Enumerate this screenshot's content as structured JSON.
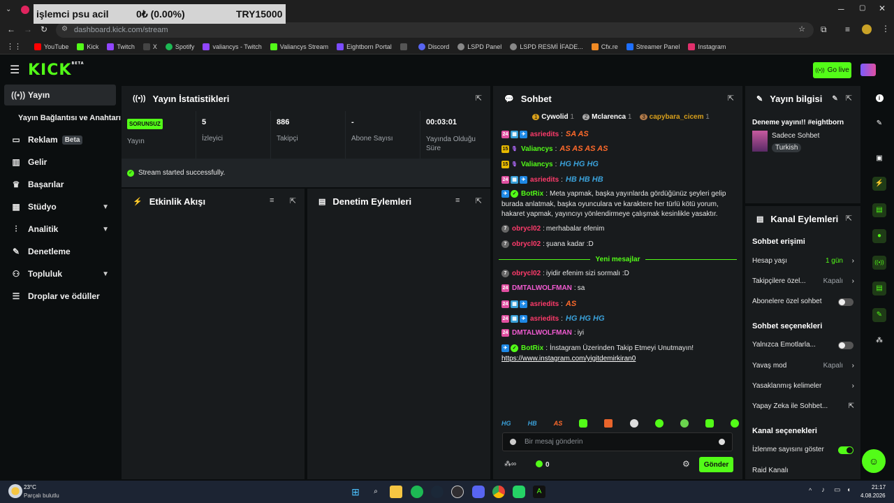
{
  "overlay": {
    "name": "işlemci psu acil",
    "value": "0₺ (0.00%)",
    "amount": "TRY15000"
  },
  "browser": {
    "url": "dashboard.kick.com/stream",
    "bookmarks": [
      "YouTube",
      "Kick",
      "Twitch",
      "X",
      "Spotify",
      "valiancys - Twitch",
      "Valiancys Stream",
      "Eightborn Portal",
      "Discord",
      "LSPD Panel",
      "LSPD RESMİ İFADE...",
      "Cfx.re",
      "Streamer Panel",
      "Instagram"
    ]
  },
  "header": {
    "logo": "KICK",
    "logo_sup": "BETA",
    "go_live": "Go live"
  },
  "sidebar": {
    "items": [
      {
        "label": "Yayın",
        "icon": "broadcast-icon"
      },
      {
        "label": "Yayın Bağlantısı ve Anahtarı",
        "icon": ""
      },
      {
        "label": "Reklam",
        "icon": "ad-icon",
        "badge": "Beta"
      },
      {
        "label": "Gelir",
        "icon": "chart-icon"
      },
      {
        "label": "Başarılar",
        "icon": "trophy-icon"
      },
      {
        "label": "Stüdyo",
        "icon": "studio-icon"
      },
      {
        "label": "Analitik",
        "icon": "analytics-icon"
      },
      {
        "label": "Denetleme",
        "icon": "wrench-icon"
      },
      {
        "label": "Topluluk",
        "icon": "community-icon"
      },
      {
        "label": "Droplar ve ödüller",
        "icon": "drops-icon"
      }
    ]
  },
  "stats": {
    "title": "Yayın İstatistikleri",
    "status_badge": "SORUNSUZ",
    "status_label": "Yayın",
    "viewers": "5",
    "viewers_label": "İzleyici",
    "followers": "886",
    "followers_label": "Takipçi",
    "subs": "-",
    "subs_label": "Abone Sayısı",
    "uptime": "00:03:01",
    "uptime_label": "Yayında Olduğu Süre",
    "success": "Stream started successfully."
  },
  "activity": {
    "title": "Etkinlik Akışı"
  },
  "moderation": {
    "title": "Denetim Eylemleri"
  },
  "chat": {
    "title": "Sohbet",
    "top": [
      {
        "rank": "1",
        "name": "Cywolid",
        "count": "1"
      },
      {
        "rank": "2",
        "name": "Mclarenca",
        "count": "1"
      },
      {
        "rank": "3",
        "name": "capybara_cicem",
        "count": "1"
      }
    ],
    "messages": [
      {
        "user": "asriedits",
        "color": "#ff3b6b",
        "emotes": "SA AS"
      },
      {
        "user": "Valiancys",
        "color": "#53fc18",
        "emotes": "AS AS AS AS"
      },
      {
        "user": "Valiancys",
        "color": "#53fc18",
        "emotes": "HG HG HG"
      },
      {
        "user": "asriedits",
        "color": "#ff3b6b",
        "emotes": "HB HB HB"
      },
      {
        "user": "BotRix",
        "color": "#53fc18",
        "text": "Meta yapmak, başka yayınlarda gördüğünüz şeyleri gelip",
        "text2": "burada anlatmak, başka oyunculara ve karaktere her türlü kötü yorum,",
        "text3": "hakaret yapmak, yayıncıyı yönlendirmeye çalışmak kesinlikle yasaktır."
      },
      {
        "user": "obrycl02",
        "color": "#ff3b6b",
        "text": "merhabalar efenim"
      },
      {
        "user": "obrycl02",
        "color": "#ff3b6b",
        "text": "şuana kadar :D"
      },
      {
        "user": "obrycl02",
        "color": "#ff3b6b",
        "text": "iyidir efenim sizi sormalı :D"
      },
      {
        "user": "DMTALWOLFMAN",
        "color": "#f15bd1",
        "text": "sa"
      },
      {
        "user": "asriedits",
        "color": "#ff3b6b",
        "emotes": "AS"
      },
      {
        "user": "asriedits",
        "color": "#ff3b6b",
        "emotes": "HG HG HG"
      },
      {
        "user": "DMTALWOLFMAN",
        "color": "#f15bd1",
        "text": "iyi"
      },
      {
        "user": "BotRix",
        "color": "#53fc18",
        "text": "İnstagram Üzerinden Takip Etmeyi Unutmayın!",
        "link": "https://www.instagram.com/yigitdemirkiran0"
      }
    ],
    "new_messages": "Yeni mesajlar",
    "input_placeholder": "Bir mesaj gönderin",
    "send": "Gönder",
    "points": "0",
    "emote_bar": [
      "HG",
      "HB",
      "AS"
    ]
  },
  "info": {
    "title": "Yayın bilgisi",
    "stream_title": "Deneme yayını!! #eightborn",
    "category": "Sadece Sohbet",
    "language": "Turkish"
  },
  "actions": {
    "title": "Kanal Eylemleri",
    "chat_access": "Sohbet erişimi",
    "account_age": "Hesap yaşı",
    "account_age_val": "1 gün",
    "followers_only": "Takipçilere özel...",
    "followers_only_val": "Kapalı",
    "subs_only": "Abonelere özel sohbet",
    "chat_options": "Sohbet seçenekleri",
    "emotes_only": "Yalnızca Emotlarla...",
    "slow_mode": "Yavaş mod",
    "slow_mode_val": "Kapalı",
    "banned_words": "Yasaklanmış kelimeler",
    "ai_chat": "Yapay Zeka ile Sohbet...",
    "channel_options": "Kanal seçenekleri",
    "show_views": "İzlenme sayısını göster",
    "raid": "Raid Kanalı"
  },
  "taskbar": {
    "temp": "23°C",
    "weather": "Parçalı bulutlu",
    "time": "21:17",
    "date": "4.08.2026"
  }
}
